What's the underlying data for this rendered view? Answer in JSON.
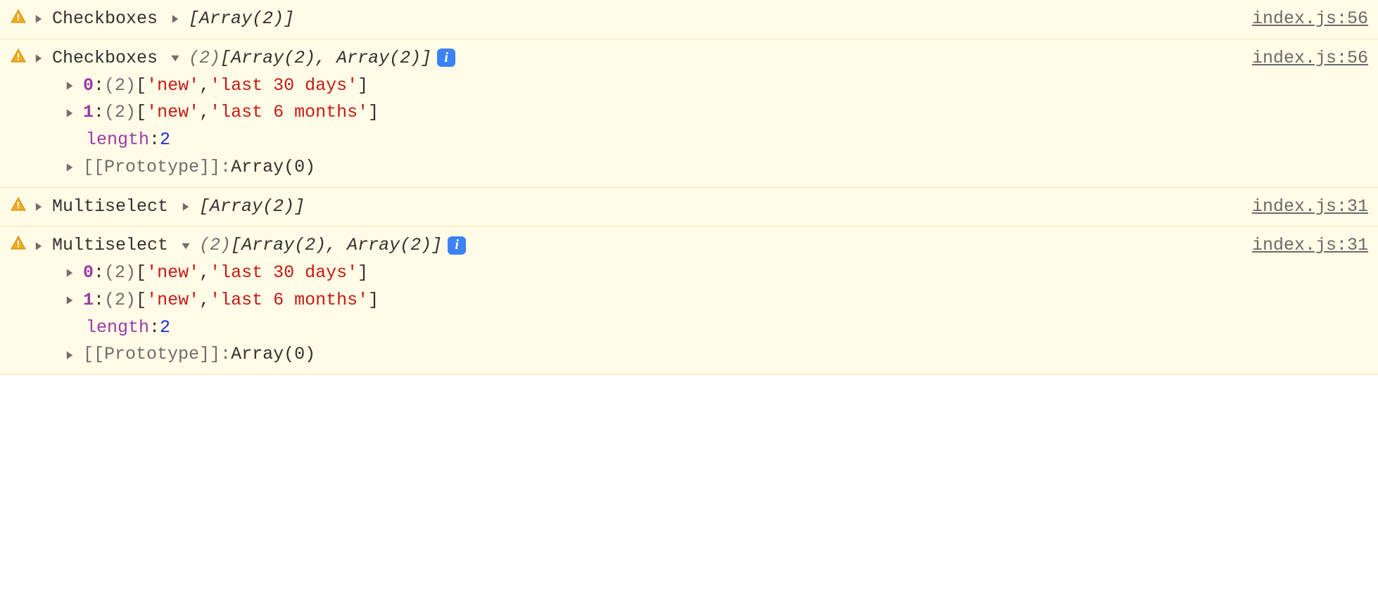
{
  "rows": [
    {
      "label": "Checkboxes",
      "expanded": false,
      "source": "index.js:56",
      "collapsed_preview": {
        "open": "[",
        "parts": [
          "Array(2)"
        ],
        "close": "]"
      }
    },
    {
      "label": "Checkboxes",
      "expanded": true,
      "source": "index.js:56",
      "expanded_summary": {
        "count": "(2)",
        "open": "[",
        "parts": [
          "Array(2)",
          "Array(2)"
        ],
        "sep": ", ",
        "close": "]"
      },
      "children": [
        {
          "idx": "0",
          "count": "(2)",
          "values": [
            "'new'",
            "'last 30 days'"
          ]
        },
        {
          "idx": "1",
          "count": "(2)",
          "values": [
            "'new'",
            "'last 6 months'"
          ]
        }
      ],
      "length_label": "length",
      "length_value": "2",
      "proto_label": "[[Prototype]]",
      "proto_value": "Array(0)"
    },
    {
      "label": "Multiselect",
      "expanded": false,
      "source": "index.js:31",
      "collapsed_preview": {
        "open": "[",
        "parts": [
          "Array(2)"
        ],
        "close": "]"
      }
    },
    {
      "label": "Multiselect",
      "expanded": true,
      "source": "index.js:31",
      "expanded_summary": {
        "count": "(2)",
        "open": "[",
        "parts": [
          "Array(2)",
          "Array(2)"
        ],
        "sep": ", ",
        "close": "]"
      },
      "children": [
        {
          "idx": "0",
          "count": "(2)",
          "values": [
            "'new'",
            "'last 30 days'"
          ]
        },
        {
          "idx": "1",
          "count": "(2)",
          "values": [
            "'new'",
            "'last 6 months'"
          ]
        }
      ],
      "length_label": "length",
      "length_value": "2",
      "proto_label": "[[Prototype]]",
      "proto_value": "Array(0)"
    }
  ],
  "glyphs": {
    "info": "i",
    "colon": ": ",
    "sep": ", "
  }
}
